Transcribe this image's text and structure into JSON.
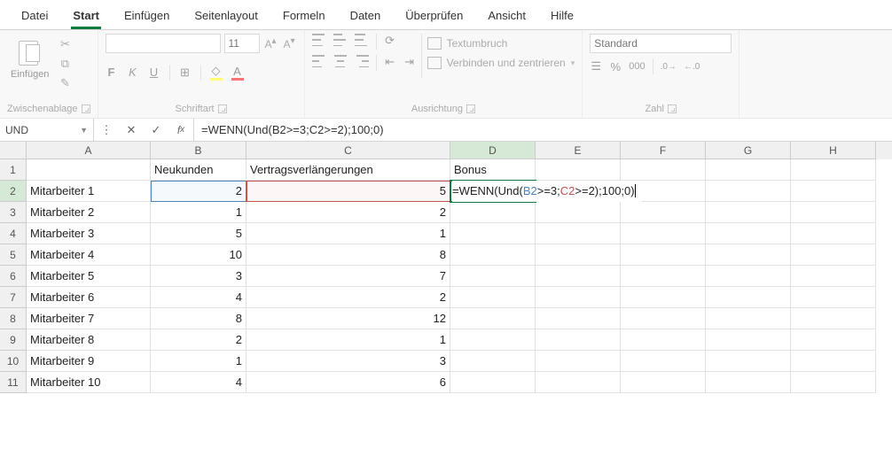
{
  "tabs": [
    "Datei",
    "Start",
    "Einfügen",
    "Seitenlayout",
    "Formeln",
    "Daten",
    "Überprüfen",
    "Ansicht",
    "Hilfe"
  ],
  "activeTab": 1,
  "ribbon": {
    "clipboard": {
      "paste": "Einfügen",
      "groupLabel": "Zwischenablage"
    },
    "font": {
      "name": "",
      "size": "11",
      "bold": "F",
      "italic": "K",
      "underline": "U",
      "groupLabel": "Schriftart"
    },
    "align": {
      "wrap": "Textumbruch",
      "merge": "Verbinden und zentrieren",
      "groupLabel": "Ausrichtung"
    },
    "number": {
      "format": "Standard",
      "groupLabel": "Zahl"
    }
  },
  "nameBox": "UND",
  "formula": "=WENN(Und(B2>=3;C2>=2);100;0)",
  "formulaParts": {
    "p1": "=WENN(Und(",
    "p2": "B2",
    "p3": ">=3;",
    "p4": "C2",
    "p5": ">=2);100;0)"
  },
  "columns": [
    "A",
    "B",
    "C",
    "D",
    "E",
    "F",
    "G",
    "H"
  ],
  "headerRow": {
    "B": "Neukunden",
    "C": "Vertragsverlängerungen",
    "D": "Bonus"
  },
  "data": [
    {
      "A": "Mitarbeiter 1",
      "B": "2",
      "C": "5"
    },
    {
      "A": "Mitarbeiter 2",
      "B": "1",
      "C": "2"
    },
    {
      "A": "Mitarbeiter 3",
      "B": "5",
      "C": "1"
    },
    {
      "A": "Mitarbeiter 4",
      "B": "10",
      "C": "8"
    },
    {
      "A": "Mitarbeiter 5",
      "B": "3",
      "C": "7"
    },
    {
      "A": "Mitarbeiter 6",
      "B": "4",
      "C": "2"
    },
    {
      "A": "Mitarbeiter 7",
      "B": "8",
      "C": "12"
    },
    {
      "A": "Mitarbeiter 8",
      "B": "2",
      "C": "1"
    },
    {
      "A": "Mitarbeiter 9",
      "B": "1",
      "C": "3"
    },
    {
      "A": "Mitarbeiter 10",
      "B": "4",
      "C": "6"
    }
  ],
  "activeCell": "D2"
}
